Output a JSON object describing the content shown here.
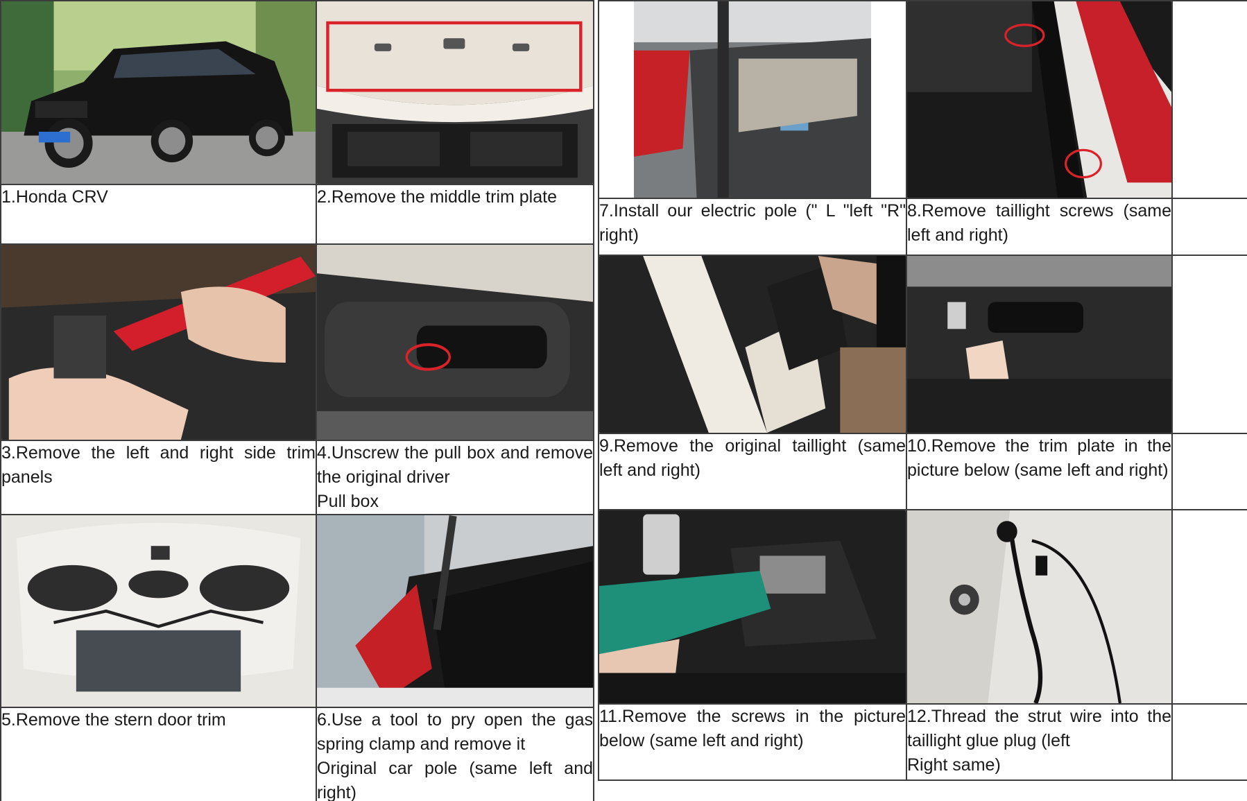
{
  "steps": [
    {
      "label": "1.Honda CRV"
    },
    {
      "label": "2.Remove the middle trim plate"
    },
    {
      "label": "3.Remove the left and right side trim panels"
    },
    {
      "label": "4.Unscrew the pull box and remove the original driver\nPull box"
    },
    {
      "label": "5.Remove the stern door trim"
    },
    {
      "label": "6.Use a tool to pry open the gas spring clamp and remove it\nOriginal car pole (same left and right)"
    },
    {
      "label": "7.Install our electric pole (\" L \"left \"R\" right)"
    },
    {
      "label": "8.Remove taillight screws (same left and right)"
    },
    {
      "label": "9.Remove the original taillight (same left and right)"
    },
    {
      "label": "10.Remove the trim plate in the picture below (same left and right)"
    },
    {
      "label": "11.Remove the screws in the picture below (same left and right)"
    },
    {
      "label": "12.Thread the strut wire into the taillight glue plug (left\nRight same)"
    }
  ],
  "colors": {
    "border": "#3c3c3c",
    "highlight": "#d9222a",
    "car_body": "#141414",
    "tool_red": "#d21f2b",
    "tool_green": "#1e8f78"
  }
}
